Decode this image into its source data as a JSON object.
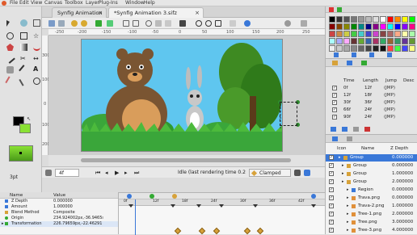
{
  "menubar": {
    "items": [
      "File",
      "Edit",
      "View",
      "Canvas",
      "Toolbox",
      "Layer",
      "Plug-Ins",
      "Window",
      "Help"
    ]
  },
  "tabs": [
    {
      "label": "Synfig Animation 1"
    },
    {
      "label": "*Synfig Animation 3.sifz"
    }
  ],
  "ruler": {
    "top": [
      "-250",
      "-200",
      "-150",
      "-100",
      "-50",
      "0",
      "50",
      "100",
      "150",
      "200",
      "250"
    ],
    "left": [
      "300",
      "100",
      "0",
      "100",
      "200"
    ]
  },
  "toolbox": {
    "width_value": "3pt"
  },
  "timebar": {
    "frame_value": "4f",
    "status_text": "Idle (last rendering time 0.2",
    "interpolation": "Clamped"
  },
  "params": {
    "headers": [
      "Name",
      "Value"
    ],
    "rows": [
      {
        "name": "Z Depth",
        "value": "0.000000"
      },
      {
        "name": "Amount",
        "value": "1.000000"
      },
      {
        "name": "Blend Method",
        "value": "Composite"
      },
      {
        "name": "Origin",
        "value": "234.924002px,-36.9465ı"
      },
      {
        "name": "Transformation",
        "value": "226.79659px,-22.46291"
      }
    ]
  },
  "timetrack": {
    "labels": [
      "0f",
      "12f",
      "18f",
      "24f",
      "30f",
      "36f",
      "42f"
    ]
  },
  "waypoints": {
    "headers": [
      "Time",
      "Length",
      "Jump",
      "Desc"
    ],
    "rows": [
      {
        "time": "0f",
        "length": "12f",
        "jump": "(JMP)"
      },
      {
        "time": "12f",
        "length": "18f",
        "jump": "(JMP)"
      },
      {
        "time": "30f",
        "length": "36f",
        "jump": "(JMP)"
      },
      {
        "time": "66f",
        "length": "24f",
        "jump": "(JMP)"
      },
      {
        "time": "90f",
        "length": "24f",
        "jump": "(JMP)"
      }
    ]
  },
  "layers": {
    "headers": [
      "Icon",
      "Name",
      "Z Depth"
    ],
    "rows": [
      {
        "name": "Group",
        "z": "0.000000"
      },
      {
        "name": "Group",
        "z": "0.000000"
      },
      {
        "name": "Group",
        "z": "1.000000"
      },
      {
        "name": "Group",
        "z": "2.000000"
      },
      {
        "name": "Region",
        "z": "0.000000"
      },
      {
        "name": "Trava.png",
        "z": "0.000000"
      },
      {
        "name": "Trava-2.png",
        "z": "1.000000"
      },
      {
        "name": "Tree-1.png",
        "z": "2.000000"
      },
      {
        "name": "Tree.png",
        "z": "3.000000"
      },
      {
        "name": "Tree-3.png",
        "z": "4.000000"
      }
    ]
  },
  "colors": {
    "sky": "#5fc6ef",
    "grass": "#3aa63a",
    "bear": "#7a5532",
    "selection": "#3a78d8",
    "keyframe": "#d7a23a"
  }
}
